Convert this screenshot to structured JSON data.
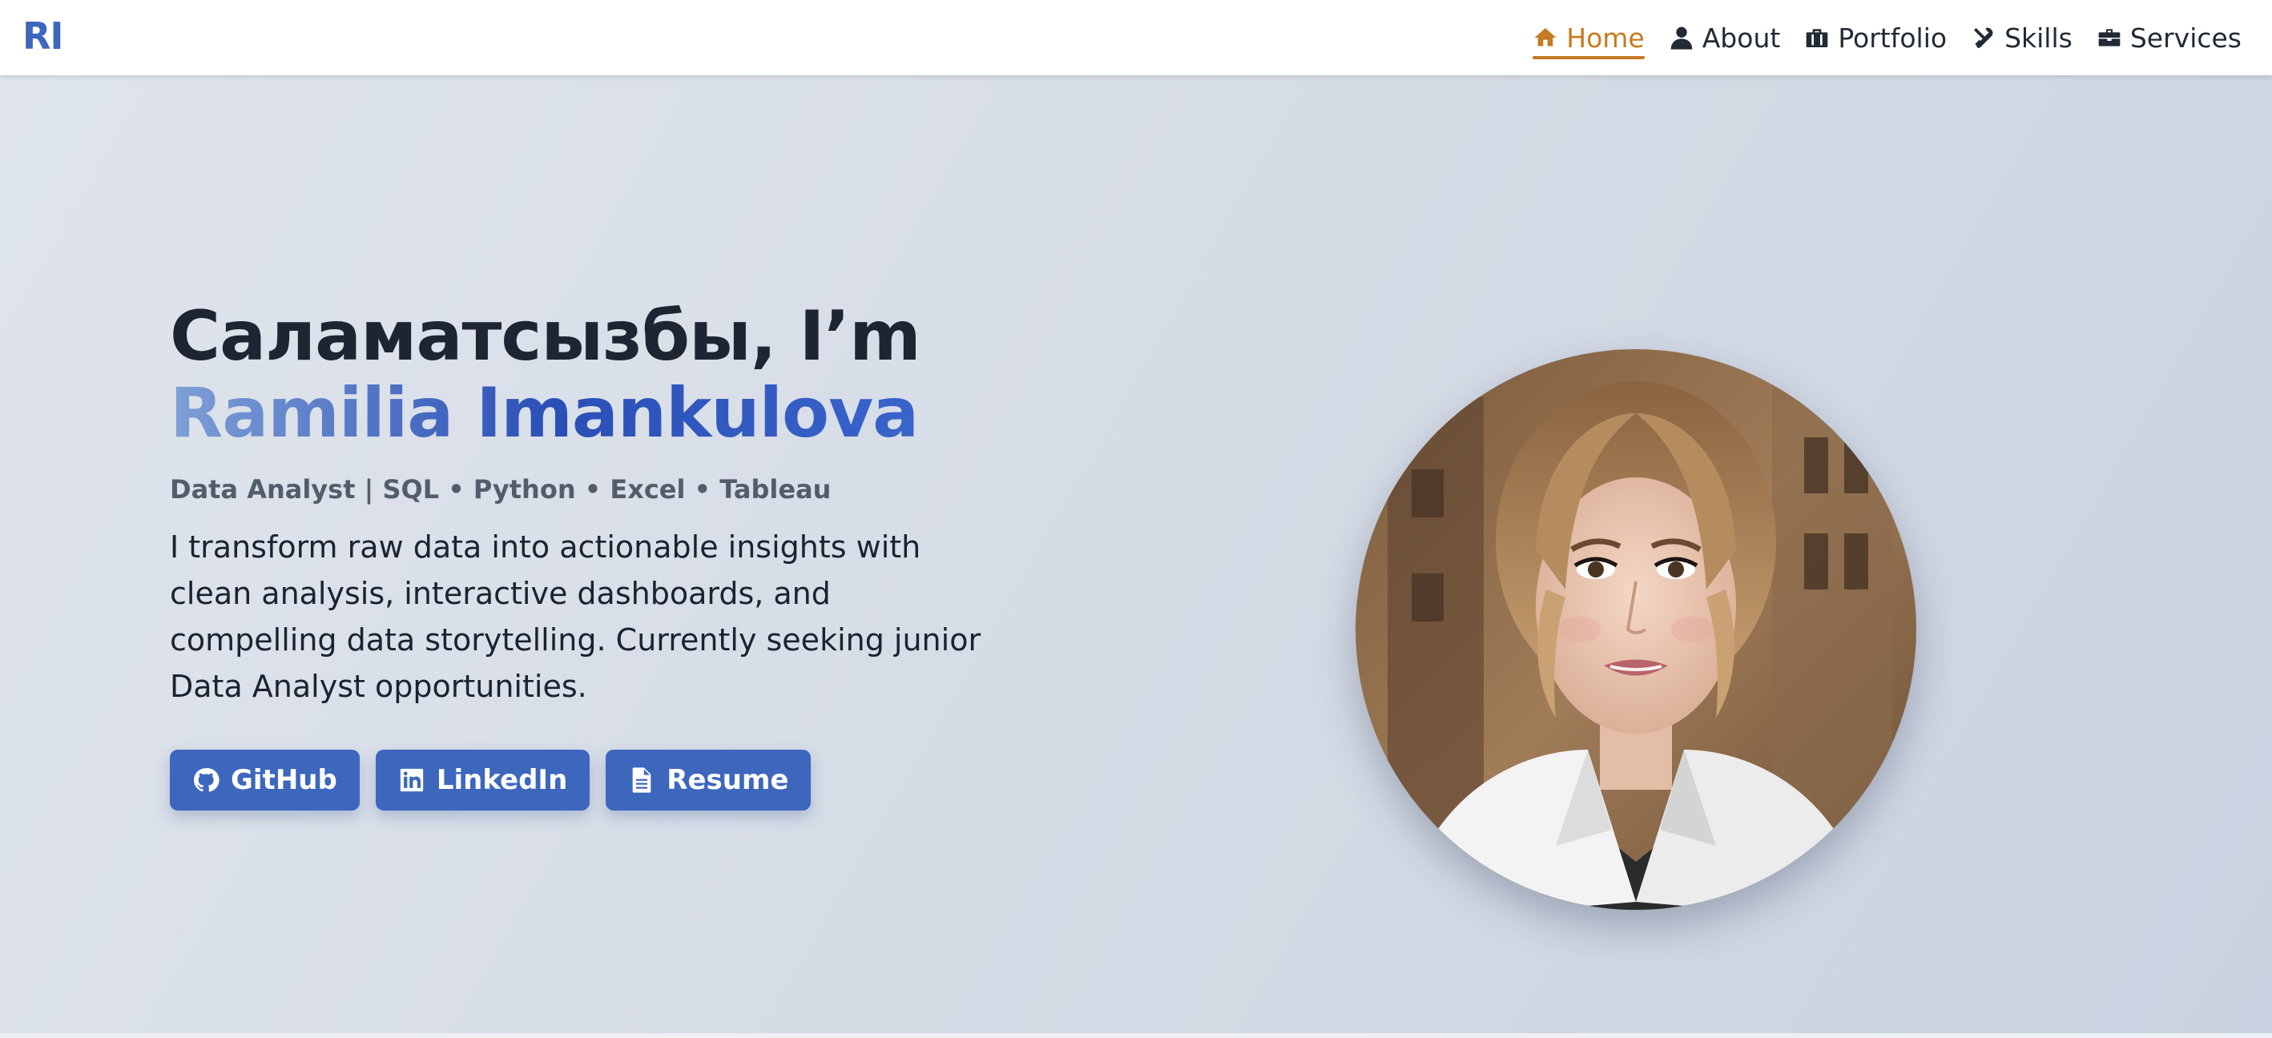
{
  "nav": {
    "logo": "RI",
    "items": [
      {
        "label": "Home",
        "icon": "home-icon",
        "active": true
      },
      {
        "label": "About",
        "icon": "user-icon",
        "active": false
      },
      {
        "label": "Portfolio",
        "icon": "briefcase-icon",
        "active": false
      },
      {
        "label": "Skills",
        "icon": "tools-icon",
        "active": false
      },
      {
        "label": "Services",
        "icon": "toolbox-icon",
        "active": false
      }
    ]
  },
  "hero": {
    "greeting": "Саламатсызбы, I’m",
    "name": "Ramilia Imankulova",
    "tagline": "Data Analyst | SQL • Python • Excel • Tableau",
    "description": "I transform raw data into actionable insights with clean analysis, interactive dashboards, and compelling data storytelling. Currently seeking junior Data Analyst opportunities.",
    "buttons": [
      {
        "label": "GitHub",
        "icon": "github-icon"
      },
      {
        "label": "LinkedIn",
        "icon": "linkedin-icon"
      },
      {
        "label": "Resume",
        "icon": "file-icon"
      }
    ],
    "portrait_alt": "profile-photo"
  },
  "colors": {
    "brand": "#3d67bd",
    "active_nav": "#c67a22",
    "heading": "#1d2533",
    "tagline": "#525d6c"
  }
}
